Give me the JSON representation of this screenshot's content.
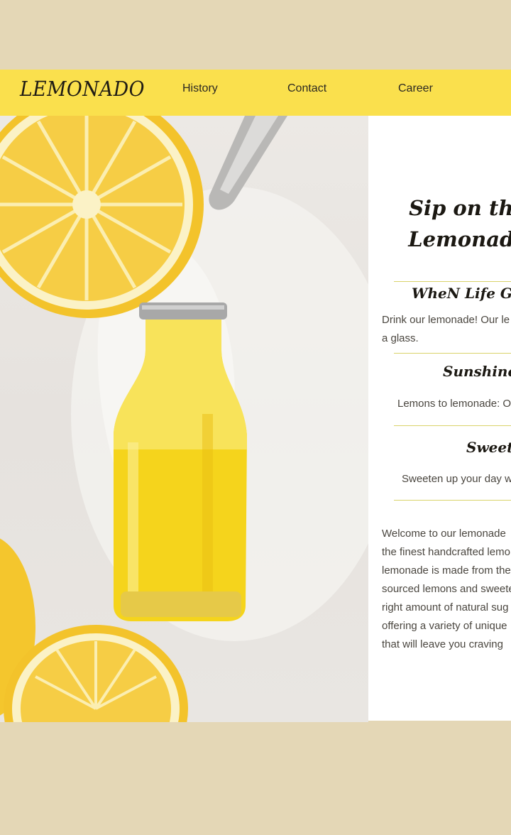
{
  "brand": {
    "logo": "LEMONADO"
  },
  "nav": {
    "items": [
      {
        "label": "History"
      },
      {
        "label": "Contact"
      },
      {
        "label": "Career"
      }
    ]
  },
  "hero": {
    "title_line1": "Sip on the",
    "title_line2": "Lemonade"
  },
  "features": [
    {
      "heading": "WheN Life Gives",
      "text_line1": "Drink our lemonade! Our le",
      "text_line2": "a glass."
    },
    {
      "heading": "Sunshine in",
      "text_line1": "Lemons to lemonade: O"
    },
    {
      "heading": "Sweeten",
      "text_line1": "Sweeten up your day w"
    }
  ],
  "welcome": {
    "lines": [
      "Welcome to our lemonade",
      "the finest handcrafted lemo",
      "lemonade is made from the",
      "sourced lemons and sweete",
      "right amount of natural sug",
      "offering a variety of unique",
      "that will leave you craving"
    ]
  },
  "colors": {
    "page_background": "#e4d7b6",
    "navbar": "#fae04d",
    "content_background": "#ffffff",
    "divider": "#d9d36a",
    "lemon": "#f6c52f"
  }
}
